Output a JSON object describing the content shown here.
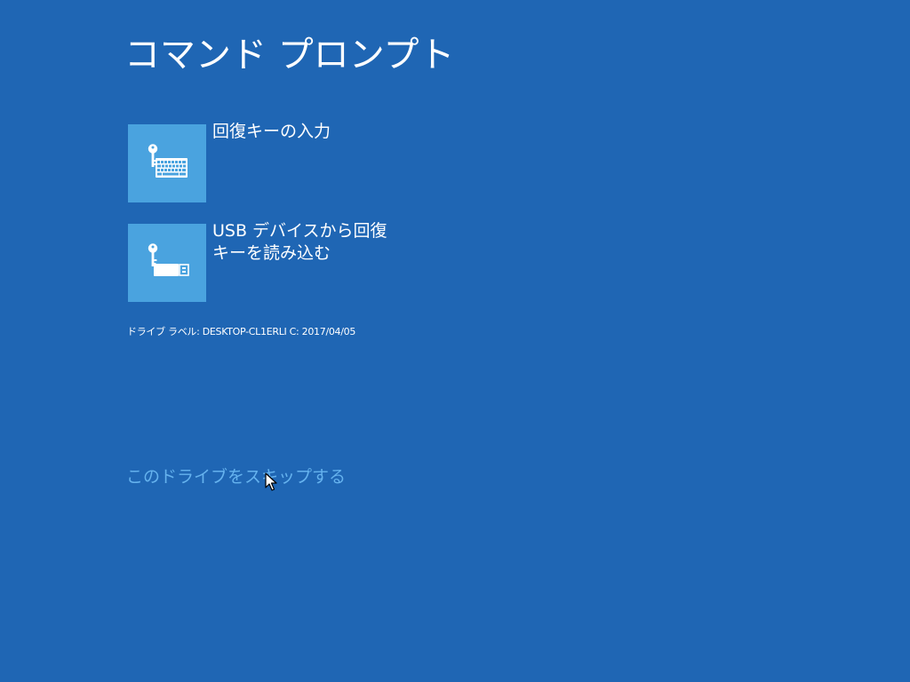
{
  "page": {
    "title": "コマンド プロンプト"
  },
  "options": [
    {
      "label": "回復キーの入力",
      "icon": "key-keyboard-icon"
    },
    {
      "label": "USB デバイスから回復キーを読み込む",
      "icon": "key-usb-icon"
    }
  ],
  "drive": {
    "label": "ドライブ ラベル: DESKTOP-CL1ERLI C: 2017/04/05"
  },
  "skip": {
    "label": "このドライブをスキップする"
  },
  "colors": {
    "background": "#1f66b4",
    "tile": "#4aa3df",
    "link": "#65b2ee",
    "text": "#ffffff"
  }
}
